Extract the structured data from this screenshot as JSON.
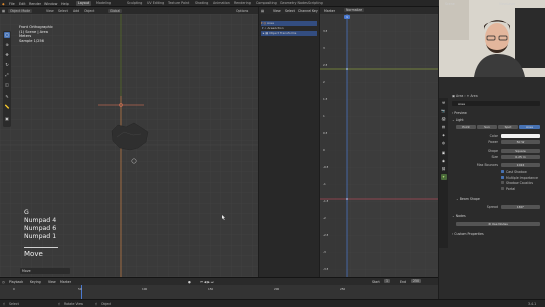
{
  "topbar": {
    "menus": [
      "File",
      "Edit",
      "Render",
      "Window",
      "Help"
    ],
    "workspaces": [
      "Layout",
      "Modeling",
      "Sculpting",
      "UV Editing",
      "Texture Paint",
      "Shading",
      "Animation",
      "Rendering",
      "Compositing",
      "Geometry Nodes",
      "Scripting"
    ],
    "active_workspace": "Layout",
    "scene": "Scene",
    "view_layer": "ViewLayer"
  },
  "viewport": {
    "mode": "Object Mode",
    "menus": [
      "View",
      "Select",
      "Add",
      "Object"
    ],
    "orientation": "Global",
    "options_label": "Options",
    "overlay_lines": [
      "Front Orthographic",
      "(1) Scene | Area",
      "Meters",
      "Sample 1/256"
    ],
    "keys": [
      "G",
      "Numpad 4",
      "Numpad 6",
      "Numpad 1"
    ],
    "operator": "Move",
    "last_op_panel": "Move"
  },
  "outliner": {
    "header_menus": [
      "View",
      "Select",
      "Channel",
      "Key"
    ],
    "rows": [
      "Area",
      "AreaAction",
      "Object Transforms"
    ]
  },
  "graph_editor": {
    "header_menus": [
      "View",
      "Select",
      "Marker",
      "Channel",
      "Key"
    ],
    "normalize_label": "Normalize",
    "frame_ticks": [
      "0",
      "50",
      "100",
      "150",
      "200"
    ],
    "value_ticks": [
      "3.5",
      "3",
      "2.5",
      "2",
      "1.5",
      "1",
      "0.5",
      "0",
      "-0.5",
      "-1",
      "-1.5",
      "-2",
      "-2.5",
      "-3",
      "-3.5",
      "-4",
      "-4.5",
      "-5"
    ],
    "colors": {
      "x_curve": "#e05066",
      "y_curve": "#a8c23a",
      "playhead": "#4a79d0"
    }
  },
  "timeline": {
    "menus": [
      "Playback",
      "Keying",
      "View",
      "Marker"
    ],
    "start_label": "Start",
    "start_value": "1",
    "end_label": "End",
    "end_value": "250",
    "current_frame": "1",
    "ticks": [
      "0",
      "50",
      "100",
      "150",
      "200",
      "250"
    ]
  },
  "statusbar": {
    "items": [
      "Select",
      "Rotate View",
      "Object"
    ],
    "version": "3.4.1"
  },
  "properties": {
    "breadcrumb": [
      "Area",
      "Area"
    ],
    "object_name": "Area",
    "sections": {
      "preview": "Preview",
      "light": "Light",
      "beam_shape": "Beam Shape",
      "nodes": "Nodes",
      "custom_props": "Custom Properties"
    },
    "light_types": [
      "Point",
      "Sun",
      "Spot",
      "Area"
    ],
    "active_light_type": "Area",
    "fields": {
      "color_label": "Color",
      "power_label": "Power",
      "power_value": "50 W",
      "shape_label": "Shape",
      "shape_value": "Square",
      "size_label": "Size",
      "size_value": "0.25 m",
      "max_bounces_label": "Max Bounces",
      "max_bounces_value": "1024",
      "spread_label": "Spread",
      "spread_value": "180°"
    },
    "checkboxes": [
      {
        "label": "Cast Shadow",
        "on": true
      },
      {
        "label": "Multiple Importance",
        "on": true
      },
      {
        "label": "Shadow Caustics",
        "on": false
      },
      {
        "label": "Portal",
        "on": false
      }
    ],
    "use_nodes_label": "Use Nodes"
  }
}
